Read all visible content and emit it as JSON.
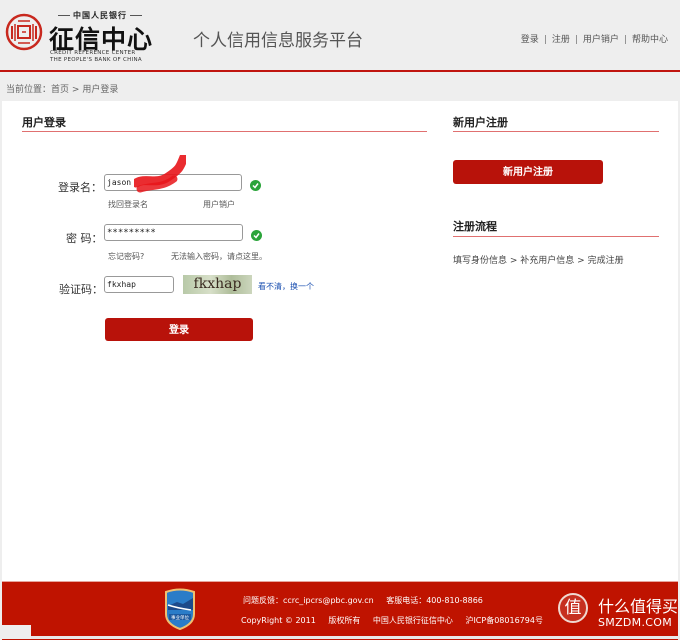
{
  "header": {
    "logo": {
      "top_line": "中国人民银行",
      "main": "征信中心",
      "english_line1": "CREDIT REFERENCE CENTER",
      "english_line2": "THE PEOPLE'S BANK OF CHINA"
    },
    "platform_title": "个人信用信息服务平台",
    "nav": [
      {
        "label": "登录"
      },
      {
        "label": "注册"
      },
      {
        "label": "用户销户"
      },
      {
        "label": "帮助中心"
      }
    ],
    "nav_separator": "|",
    "accent_color": "#c0150f"
  },
  "breadcrumb": {
    "prefix": "当前位置：",
    "items": [
      {
        "label": "首页"
      },
      {
        "label": "用户登录"
      }
    ],
    "separator": ">"
  },
  "login": {
    "section_title": "用户登录",
    "username": {
      "label": "登录名：",
      "value": "jason",
      "valid": true,
      "links": [
        {
          "label": "找回登录名"
        },
        {
          "label": "用户销户"
        }
      ]
    },
    "password": {
      "label": "密  码：",
      "value": "*********",
      "valid": true,
      "links": [
        {
          "label": "忘记密码?"
        },
        {
          "label": "无法输入密码，请点这里。"
        }
      ]
    },
    "captcha": {
      "label": "验证码：",
      "value": "fkxhap",
      "image_text": "fkxhap",
      "refresh_label": "看不清，换一个"
    },
    "submit_label": "登录"
  },
  "register": {
    "section_title": "新用户注册",
    "button_label": "新用户注册",
    "flow_title": "注册流程",
    "flow_steps": [
      "填写身份信息",
      "补充用户信息",
      "完成注册"
    ],
    "flow_separator": " > "
  },
  "footer": {
    "badge_label": "事业单位",
    "feedback_label": "问题反馈：",
    "feedback_email": "ccrc_ipcrs@pbc.gov.cn",
    "service_label": "客服电话：",
    "service_phone": "400-810-8866",
    "copyright": "CopyRight © 2011",
    "rights": "版权所有",
    "org": "中国人民银行征信中心",
    "icp": "沪ICP备08016794号",
    "background_color": "#bf1300"
  },
  "watermark": {
    "glyph": "值",
    "cn": "什么值得买",
    "en": "SMZDM.COM"
  }
}
